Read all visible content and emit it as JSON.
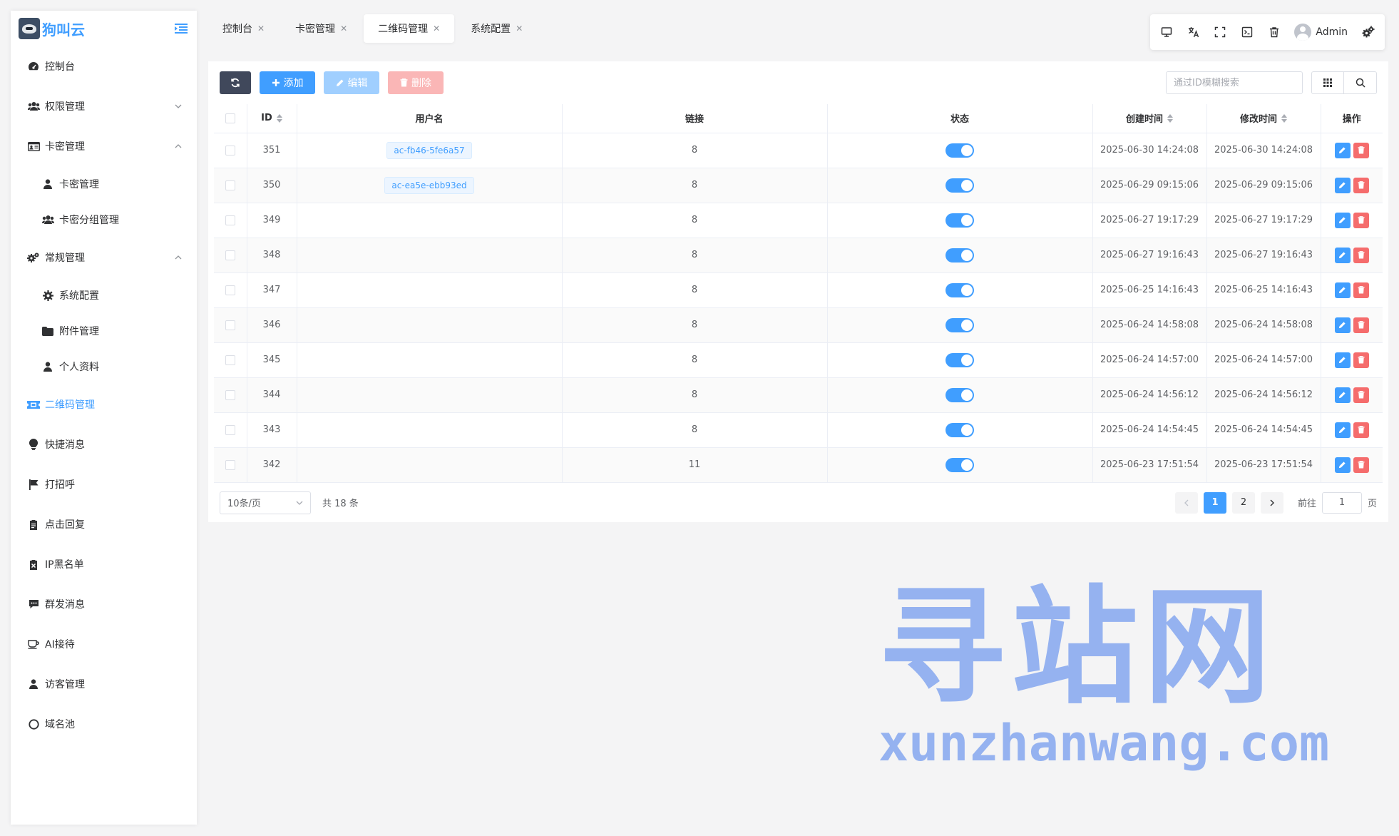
{
  "brand": {
    "name": "狗叫云"
  },
  "sidebar": {
    "items": [
      {
        "label": "控制台",
        "icon": "dashboard-icon"
      },
      {
        "label": "权限管理",
        "icon": "users-icon",
        "expand": "down"
      },
      {
        "label": "卡密管理",
        "icon": "id-card-icon",
        "expand": "up"
      },
      {
        "label": "卡密管理",
        "icon": "user-icon",
        "sub": true
      },
      {
        "label": "卡密分组管理",
        "icon": "users-icon",
        "sub": true
      },
      {
        "label": "常规管理",
        "icon": "gears-icon",
        "expand": "up"
      },
      {
        "label": "系统配置",
        "icon": "gear-icon",
        "sub": true
      },
      {
        "label": "附件管理",
        "icon": "folder-icon",
        "sub": true
      },
      {
        "label": "个人资料",
        "icon": "user-icon",
        "sub": true
      },
      {
        "label": "二维码管理",
        "icon": "ticket-icon",
        "active": true
      },
      {
        "label": "快捷消息",
        "icon": "lightbulb-icon"
      },
      {
        "label": "打招呼",
        "icon": "flag-icon"
      },
      {
        "label": "点击回复",
        "icon": "clipboard-icon"
      },
      {
        "label": "IP黑名单",
        "icon": "blacklist-icon"
      },
      {
        "label": "群发消息",
        "icon": "chat-icon"
      },
      {
        "label": "AI接待",
        "icon": "cup-icon"
      },
      {
        "label": "访客管理",
        "icon": "user-icon"
      },
      {
        "label": "域名池",
        "icon": "circle-icon"
      }
    ]
  },
  "tabs": [
    {
      "label": "控制台",
      "active": false
    },
    {
      "label": "卡密管理",
      "active": false
    },
    {
      "label": "二维码管理",
      "active": true
    },
    {
      "label": "系统配置",
      "active": false
    }
  ],
  "header": {
    "user_name": "Admin"
  },
  "toolbar": {
    "add_label": "添加",
    "edit_label": "编辑",
    "delete_label": "删除",
    "search_placeholder": "通过ID模糊搜索"
  },
  "table": {
    "columns": [
      "ID",
      "用户名",
      "链接",
      "状态",
      "创建时间",
      "修改时间",
      "操作"
    ],
    "rows": [
      {
        "id": "351",
        "username": "ac-fb46-5fe6a57",
        "link": "8",
        "status": true,
        "created": "2025-06-30 14:24:08",
        "updated": "2025-06-30 14:24:08"
      },
      {
        "id": "350",
        "username": "ac-ea5e-ebb93ed",
        "link": "8",
        "status": true,
        "created": "2025-06-29 09:15:06",
        "updated": "2025-06-29 09:15:06"
      },
      {
        "id": "349",
        "username": "",
        "link": "8",
        "status": true,
        "created": "2025-06-27 19:17:29",
        "updated": "2025-06-27 19:17:29"
      },
      {
        "id": "348",
        "username": "",
        "link": "8",
        "status": true,
        "created": "2025-06-27 19:16:43",
        "updated": "2025-06-27 19:16:43"
      },
      {
        "id": "347",
        "username": "",
        "link": "8",
        "status": true,
        "created": "2025-06-25 14:16:43",
        "updated": "2025-06-25 14:16:43"
      },
      {
        "id": "346",
        "username": "",
        "link": "8",
        "status": true,
        "created": "2025-06-24 14:58:08",
        "updated": "2025-06-24 14:58:08"
      },
      {
        "id": "345",
        "username": "",
        "link": "8",
        "status": true,
        "created": "2025-06-24 14:57:00",
        "updated": "2025-06-24 14:57:00"
      },
      {
        "id": "344",
        "username": "",
        "link": "8",
        "status": true,
        "created": "2025-06-24 14:56:12",
        "updated": "2025-06-24 14:56:12"
      },
      {
        "id": "343",
        "username": "",
        "link": "8",
        "status": true,
        "created": "2025-06-24 14:54:45",
        "updated": "2025-06-24 14:54:45"
      },
      {
        "id": "342",
        "username": "",
        "link": "11",
        "status": true,
        "created": "2025-06-23 17:51:54",
        "updated": "2025-06-23 17:51:54"
      }
    ]
  },
  "pagination": {
    "page_size": "10条/页",
    "total": "共 18 条",
    "pages": [
      "1",
      "2"
    ],
    "current_page": "1",
    "goto_prefix": "前往",
    "goto_value": "1",
    "goto_suffix": "页"
  },
  "watermark": {
    "cn": "寻站网",
    "en": "xunzhanwang.com"
  },
  "colors": {
    "primary": "#409eff",
    "danger": "#f56c6c",
    "dark": "#40485b",
    "background": "#f4f4f5"
  }
}
